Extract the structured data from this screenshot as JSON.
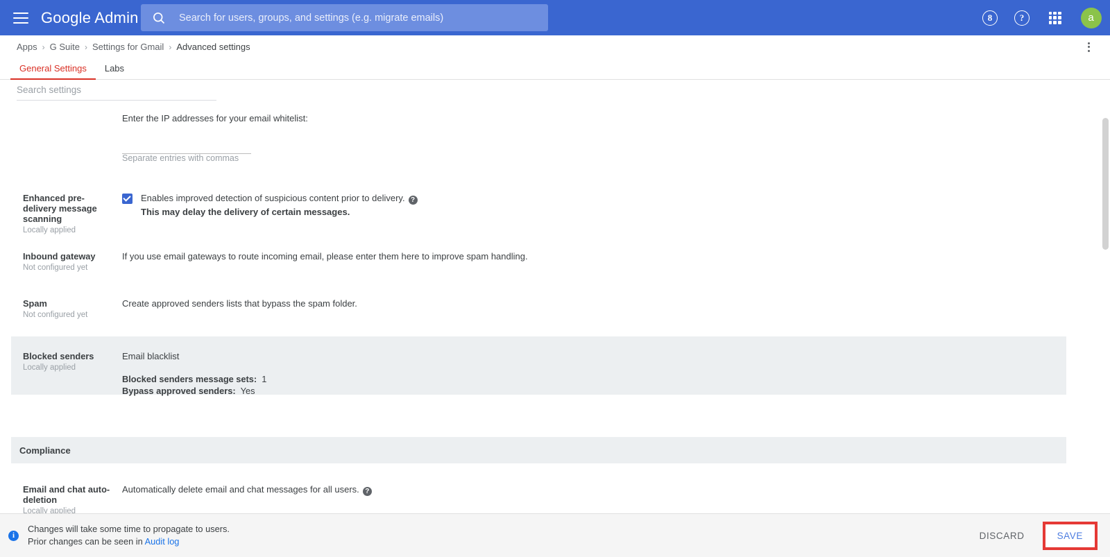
{
  "appbar": {
    "menu_icon": "hamburger-icon",
    "brand": "Google Admin",
    "search_placeholder": "Search for users, groups, and settings (e.g. migrate emails)",
    "search_value": "",
    "search_icon": "search-icon",
    "support_icon_label": "8",
    "help_icon_label": "?",
    "apps_icon": "apps-grid-icon",
    "avatar_initial": "a",
    "colors": {
      "bar": "#3a66d0",
      "search_field": "#6d8ee0",
      "avatar": "#8bc34a"
    }
  },
  "breadcrumb": {
    "items": [
      "Apps",
      "G Suite",
      "Settings for Gmail",
      "Advanced settings"
    ],
    "separator": "›",
    "overflow_icon": "more-vert-icon"
  },
  "tabs": [
    {
      "label": "General Settings",
      "active": true
    },
    {
      "label": "Labs",
      "active": false
    }
  ],
  "settings_search": {
    "placeholder": "Search settings",
    "value": ""
  },
  "rows": {
    "ip_whitelist": {
      "description": "Enter the IP addresses for your email whitelist:",
      "input_value": "",
      "hint": "Separate entries with commas"
    },
    "enhanced_scanning": {
      "label": "Enhanced pre-delivery message scanning",
      "status": "Locally applied",
      "checkbox_checked": true,
      "checkbox_text": "Enables improved detection of suspicious content prior to delivery.",
      "help_icon": "help-icon",
      "note": "This may delay the delivery of certain messages."
    },
    "inbound_gateway": {
      "label": "Inbound gateway",
      "status": "Not configured yet",
      "description": "If you use email gateways to route incoming email, please enter them here to improve spam handling."
    },
    "spam": {
      "label": "Spam",
      "status": "Not configured yet",
      "description": "Create approved senders lists that bypass the spam folder."
    },
    "blocked_senders": {
      "label": "Blocked senders",
      "status": "Locally applied",
      "title": "Email blacklist",
      "fields": [
        {
          "key": "Blocked senders message sets:",
          "value": "1"
        },
        {
          "key": "Bypass approved senders:",
          "value": "Yes"
        }
      ]
    },
    "compliance_header": "Compliance",
    "auto_deletion": {
      "label": "Email and chat auto-deletion",
      "status": "Locally applied",
      "description": "Automatically delete email and chat messages for all users.",
      "help_icon": "help-icon"
    }
  },
  "bottom_bar": {
    "info_icon": "info-icon",
    "line1": "Changes will take some time to propagate to users.",
    "line2_prefix": "Prior changes can be seen in",
    "line2_link": "Audit log",
    "discard_label": "DISCARD",
    "save_label": "SAVE",
    "save_highlight_color": "#e53935"
  }
}
